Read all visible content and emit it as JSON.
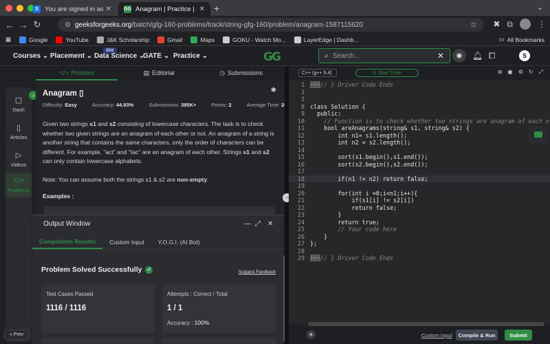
{
  "browser": {
    "tabs": [
      {
        "title": "You are signed in as Devang",
        "favicon": "S",
        "favicon_color": "#1a73e8"
      },
      {
        "title": "Anagram | Practice | Geeksfo",
        "favicon": "GG",
        "favicon_color": "#2f8d46"
      }
    ],
    "new_tab": "+",
    "url_host": "geeksforgeeks.org",
    "url_path": "/batch/gfg-160-problems/track/string-gfg-160/problem/anagram-1587115620",
    "bookmarks": [
      {
        "label": "Google",
        "color": "#4285f4"
      },
      {
        "label": "YouTube",
        "color": "#ff0000"
      },
      {
        "label": "J&K Scholarship",
        "color": "#aaaaaa"
      },
      {
        "label": "Gmail",
        "color": "#ea4335"
      },
      {
        "label": "Maps",
        "color": "#34a853"
      },
      {
        "label": "GOKU - Watch Mo...",
        "color": "#cccccc"
      },
      {
        "label": "LayerEdge | Dashb...",
        "color": "#cccccc"
      }
    ],
    "all_bookmarks": "All Bookmarks"
  },
  "header": {
    "menu": [
      "Courses",
      "Placement",
      "Data Science",
      "GATE",
      "Practice"
    ],
    "ibm_badge": "IBM",
    "logo": "GG",
    "search_placeholder": "Search...",
    "user_initial": "S"
  },
  "rail": {
    "items": [
      "Dash",
      "Articles",
      "Videos",
      "Problems"
    ],
    "prev": "Prev"
  },
  "problem_tabs": [
    "Problem",
    "Editorial",
    "Submissions"
  ],
  "problem": {
    "title": "Anagram",
    "difficulty_label": "Difficulty:",
    "difficulty": "Easy",
    "accuracy_label": "Accuracy:",
    "accuracy": "44.93%",
    "submissions_label": "Submissions:",
    "submissions": "395K+",
    "points_label": "Points:",
    "points": "2",
    "avg_time_label": "Average Time:",
    "avg_time": "20m",
    "desc_1": "Given two strings ",
    "s1": "s1",
    "desc_2": " and ",
    "s2": "s2",
    "desc_3": " consisting of lowercase characters. The task is to check whether two given strings are an anagram of each other or not. An anagram of a string is another string that contains the same characters, only the order of characters can be different. For example, \"act\" and \"tac\" are an anagram of each other. Strings ",
    "desc_4": " and ",
    "desc_5": " can only contain lowercase alphabets.",
    "note_1": "Note: You can assume both the strings s1 & s2 are ",
    "note_bold": "non-empty",
    "note_2": ".",
    "examples": "Examples :"
  },
  "output": {
    "title": "Output Window",
    "tabs": [
      "Compilation Results",
      "Custom Input",
      "Y.O.G.I. (AI Bot)"
    ],
    "status": "Problem Solved Successfully",
    "feedback": "Suggest Feedback",
    "card1_label": "Test Cases Passed",
    "card1_value": "1116 / 1116",
    "card2_label": "Attempts : Correct / Total",
    "card2_value": "1 / 1",
    "accuracy_label": "Accuracy : ",
    "accuracy_value": "100%"
  },
  "editor": {
    "language": "C++ (g++ 5.4)",
    "timer": "Start Timer",
    "lines": [
      {
        "n": "1",
        "code": "// } Driver Code Ends",
        "type": "fold"
      },
      {
        "n": "2",
        "code": "",
        "type": "normal"
      },
      {
        "n": "3",
        "code": "",
        "type": "normal"
      },
      {
        "n": "8",
        "code": "class Solution {",
        "type": "normal"
      },
      {
        "n": "9",
        "code": "  public:",
        "type": "normal"
      },
      {
        "n": "10",
        "code": "    // Function is to check whether two strings are anagram of each other or not.",
        "type": "comment"
      },
      {
        "n": "11",
        "code": "    bool areAnagrams(string& s1, string& s2) {",
        "type": "normal"
      },
      {
        "n": "12",
        "code": "        int n1= s1.length();",
        "type": "normal"
      },
      {
        "n": "13",
        "code": "        int n2 = s2.length();",
        "type": "normal"
      },
      {
        "n": "14",
        "code": "",
        "type": "normal"
      },
      {
        "n": "15",
        "code": "        sort(s1.begin(),s1.end());",
        "type": "normal"
      },
      {
        "n": "16",
        "code": "        sort(s2.begin(),s2.end());",
        "type": "normal"
      },
      {
        "n": "17",
        "code": "",
        "type": "normal"
      },
      {
        "n": "18",
        "code": "        if(n1 != n2) return false;",
        "type": "highlight"
      },
      {
        "n": "19",
        "code": "",
        "type": "normal"
      },
      {
        "n": "20",
        "code": "        for(int i =0;i<n1;i++){",
        "type": "normal"
      },
      {
        "n": "21",
        "code": "            if(s1[i] != s2[i])",
        "type": "normal"
      },
      {
        "n": "22",
        "code": "            return false;",
        "type": "normal"
      },
      {
        "n": "23",
        "code": "        }",
        "type": "normal"
      },
      {
        "n": "24",
        "code": "        return true;",
        "type": "normal"
      },
      {
        "n": "25",
        "code": "        // Your code here",
        "type": "comment"
      },
      {
        "n": "26",
        "code": "    }",
        "type": "normal"
      },
      {
        "n": "27",
        "code": "};",
        "type": "normal"
      },
      {
        "n": "28",
        "code": "",
        "type": "normal"
      },
      {
        "n": "29",
        "code": "// } Driver Code Ends",
        "type": "fold"
      }
    ],
    "custom_input": "Custom Input",
    "compile_run": "Compile & Run",
    "submit": "Submit"
  },
  "colors": {
    "accent": "#2f8d46",
    "background": "#1f2023"
  }
}
